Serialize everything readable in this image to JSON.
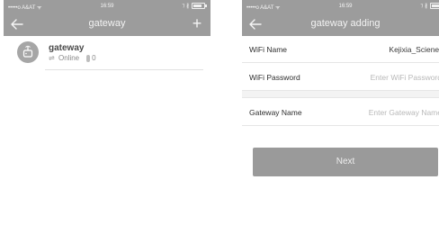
{
  "status_bar": {
    "carrier": "•••••o A&AT  ᯤ",
    "time": "16:59",
    "indicators": "⁊ ∦"
  },
  "left_screen": {
    "title": "gateway",
    "add_symbol": "+",
    "device": {
      "name": "gateway",
      "status": "Online",
      "status_icon": "⇌",
      "count": "0"
    }
  },
  "right_screen": {
    "title": "gateway adding",
    "wifi_name": {
      "label": "WiFi Name",
      "value": "Kejixia_Sciener"
    },
    "wifi_password": {
      "label": "WiFi Password",
      "placeholder": "Enter WiFi Password"
    },
    "gateway_name": {
      "label": "Gateway Name",
      "placeholder": "Enter Gateway Name"
    },
    "next_label": "Next"
  },
  "colors": {
    "nav_bar": "#9c9c9c",
    "button": "#9a9a9a",
    "background": "#ffffff"
  },
  "icons": [
    "back-arrow-icon",
    "add-icon",
    "gateway-device-icon",
    "sync-arrows-icon",
    "thermometer-icon",
    "signal-icon",
    "battery-icon"
  ]
}
